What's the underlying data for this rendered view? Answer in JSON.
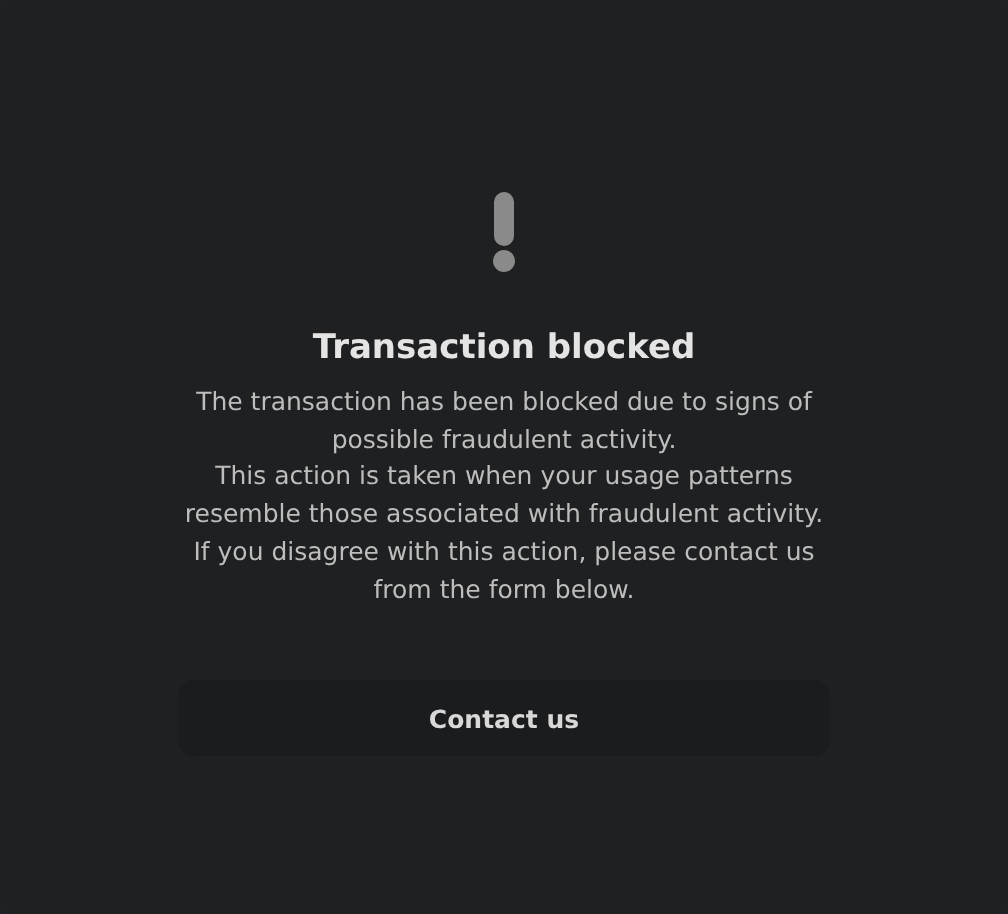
{
  "title": "Transaction blocked",
  "paragraphs": [
    "The transaction has been blocked due to signs of possible fraudulent activity.",
    "This action is taken when your usage patterns resemble those associated with fraudulent activity.",
    "If you disagree with this action, please contact us from the form below."
  ],
  "button": {
    "label": "Contact us"
  }
}
